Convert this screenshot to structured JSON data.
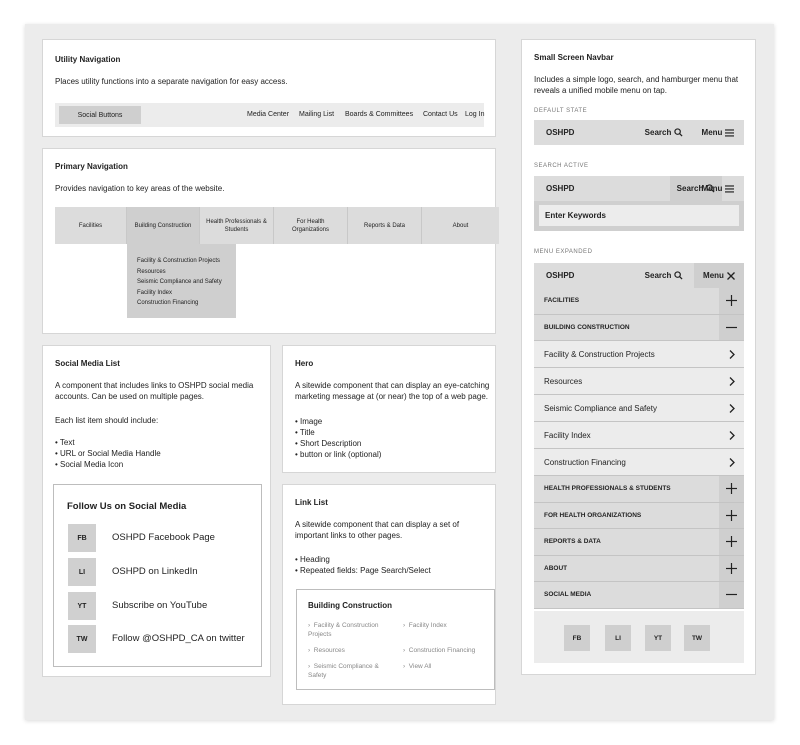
{
  "utility": {
    "title": "Utility Navigation",
    "description": "Places utility functions into a separate navigation for easy access.",
    "social_buttons": "Social Buttons",
    "links": [
      "Media Center",
      "Mailing List",
      "Boards & Committees",
      "Contact Us",
      "Log In"
    ]
  },
  "primary": {
    "title": "Primary Navigation",
    "description": "Provides navigation to key areas of the website.",
    "items": [
      "Facilities",
      "Building Construction",
      "Health Professionals & Students",
      "For Health Organizations",
      "Reports & Data",
      "About"
    ],
    "dropdown": [
      "Facility & Construction Projects",
      "Resources",
      "Seismic Compliance and Safety",
      "Facility Index",
      "Construction Financing"
    ]
  },
  "social_list": {
    "title": "Social Media List",
    "description": "A component that includes links to OSHPD social media accounts. Can be used on multiple pages.",
    "each_label": "Each list item should include:",
    "bullets": [
      "• Text",
      "• URL or Social Media Handle",
      "• Social Media Icon"
    ],
    "box_title": "Follow Us on Social Media",
    "items": [
      {
        "badge": "FB",
        "text": "OSHPD Facebook Page"
      },
      {
        "badge": "LI",
        "text": "OSHPD on LinkedIn"
      },
      {
        "badge": "YT",
        "text": "Subscribe on YouTube"
      },
      {
        "badge": "TW",
        "text": "Follow @OSHPD_CA on twitter"
      }
    ]
  },
  "hero": {
    "title": "Hero",
    "description": "A sitewide component that can display an eye-catching marketing message at (or near) the top of a web page.",
    "bullets": [
      "• Image",
      "• Title",
      "• Short Description",
      "• button or link (optional)"
    ]
  },
  "link_list": {
    "title": "Link List",
    "description": "A sitewide component that can display a set of important links to other pages.",
    "bullets": [
      "• Heading",
      "• Repeated fields: Page Search/Select"
    ],
    "box_title": "Building Construction",
    "links": [
      "Facility & Construction Projects",
      "Facility Index",
      "Resources",
      "Construction Financing",
      "Seismic Compliance & Safety",
      "View All"
    ]
  },
  "mobile": {
    "title": "Small Screen Navbar",
    "description": "Includes a simple logo, search, and hamburger menu that reveals a unified mobile menu on tap.",
    "default_label": "DEFAULT STATE",
    "search_label": "SEARCH ACTIVE",
    "expanded_label": "MENU EXPANDED",
    "logo": "OSHPD",
    "search": "Search",
    "menu": "Menu",
    "search_placeholder": "Enter Keywords",
    "menu_items": [
      {
        "label": "FACILITIES",
        "type": "cat",
        "state": "plus"
      },
      {
        "label": "BUILDING CONSTRUCTION",
        "type": "cat",
        "state": "minus"
      },
      {
        "label": "Facility & Construction Projects",
        "type": "sub",
        "state": "chevron"
      },
      {
        "label": "Resources",
        "type": "sub",
        "state": "chevron"
      },
      {
        "label": "Seismic Compliance and Safety",
        "type": "sub",
        "state": "chevron"
      },
      {
        "label": "Facility Index",
        "type": "sub",
        "state": "chevron"
      },
      {
        "label": "Construction Financing",
        "type": "sub",
        "state": "chevron"
      },
      {
        "label": "HEALTH PROFESSIONALS & STUDENTS",
        "type": "cat",
        "state": "plus"
      },
      {
        "label": "FOR HEALTH ORGANIZATIONS",
        "type": "cat",
        "state": "plus"
      },
      {
        "label": "REPORTS & DATA",
        "type": "cat",
        "state": "plus"
      },
      {
        "label": "ABOUT",
        "type": "cat",
        "state": "plus"
      },
      {
        "label": "SOCIAL MEDIA",
        "type": "cat",
        "state": "minus"
      }
    ],
    "social_badges": [
      "FB",
      "LI",
      "YT",
      "TW"
    ]
  }
}
